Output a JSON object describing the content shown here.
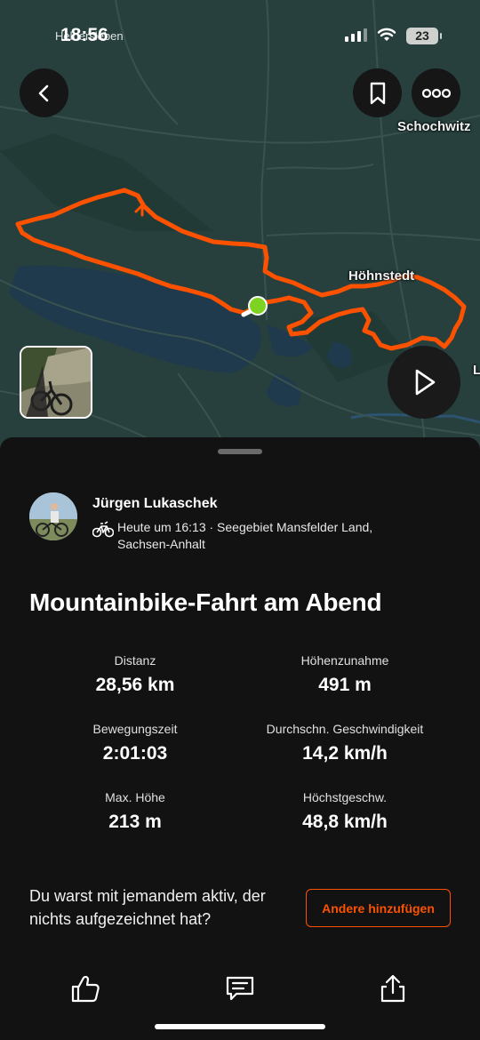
{
  "status_bar": {
    "time": "18:56",
    "carrier_text": "Helbersleben",
    "battery": "23"
  },
  "map": {
    "labels": {
      "place_1": "Schochwitz",
      "place_2": "Höhnstedt",
      "edge_letter": "L"
    },
    "colors": {
      "route": "#fc5200",
      "start_marker": "#7ed321",
      "water": "#1f3a4c",
      "land": "#27403d"
    },
    "buttons": {
      "back_icon": "chevron-left-icon",
      "bookmark_icon": "bookmark-icon",
      "more_icon": "more-icon",
      "play_icon": "play-icon"
    }
  },
  "athlete": {
    "name": "Jürgen Lukaschek",
    "meta": "Heute um 16:13 · Seegebiet Mansfelder Land, Sachsen-Anhalt",
    "activity_icon": "mountain-bike-icon"
  },
  "activity": {
    "title": "Mountainbike-Fahrt am Abend"
  },
  "stats": [
    {
      "label": "Distanz",
      "value": "28,56 km"
    },
    {
      "label": "Höhenzunahme",
      "value": "491 m"
    },
    {
      "label": "Bewegungszeit",
      "value": "2:01:03"
    },
    {
      "label": "Durchschn. Geschwindigkeit",
      "value": "14,2 km/h"
    },
    {
      "label": "Max. Höhe",
      "value": "213 m"
    },
    {
      "label": "Höchstgeschw.",
      "value": "48,8 km/h"
    }
  ],
  "prompt": {
    "text": "Du warst mit jemandem aktiv, der nichts aufgezeichnet hat?",
    "button_label": "Andere hinzufügen"
  },
  "actions": {
    "kudos_icon": "thumbs-up-icon",
    "comment_icon": "comment-icon",
    "share_icon": "share-icon"
  },
  "accent_color": "#fc5200"
}
